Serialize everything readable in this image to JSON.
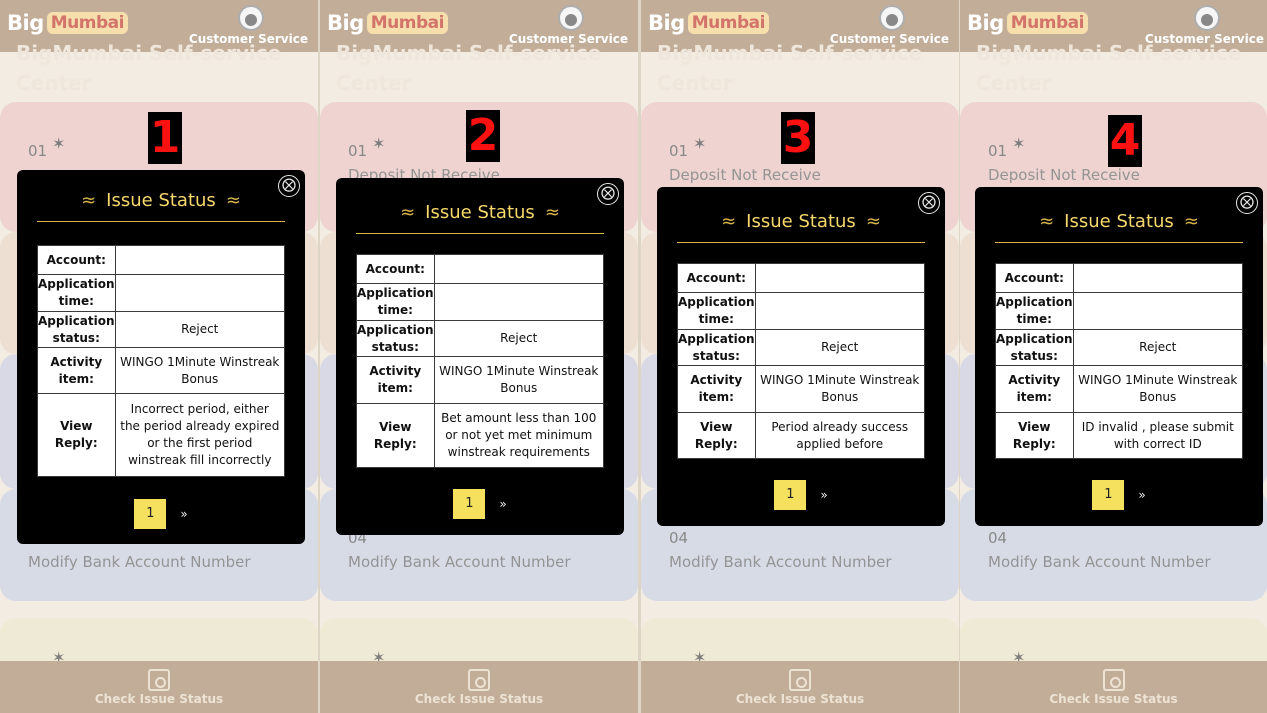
{
  "header": {
    "logo_big": "Big",
    "logo_mumbai": "Mumbai",
    "customer_service": "Customer Service"
  },
  "page": {
    "title_line1": "BigMumbai Self-service",
    "title_line2": "Center"
  },
  "cards": {
    "c1_num": "01",
    "c1_label": "Deposit Not Receive",
    "c4_num": "04",
    "c4_label": "Modify Bank Account Number"
  },
  "icons": {
    "star": "✶"
  },
  "footer": {
    "check_status": "Check Issue Status"
  },
  "modal": {
    "title": "Issue Status",
    "swirl_left": "≈",
    "swirl_right": "≈",
    "close": "⨂",
    "labels": {
      "account": "Account:",
      "application_time": "Application time:",
      "application_status": "Application status:",
      "activity_item": "Activity item:",
      "view_reply": "View Reply:"
    },
    "page_current": "1",
    "page_next": "»"
  },
  "panels": [
    {
      "number": "1",
      "status": "Reject",
      "activity": "WINGO 1Minute Winstreak Bonus",
      "reply": "Incorrect period, either the period already expired or the first period winstreak fill incorrectly"
    },
    {
      "number": "2",
      "status": "Reject",
      "activity": "WINGO 1Minute Winstreak Bonus",
      "reply": "Bet amount less than 100 or not yet met minimum winstreak requirements"
    },
    {
      "number": "3",
      "status": "Reject",
      "activity": "WINGO 1Minute Winstreak Bonus",
      "reply": "Period already success applied before"
    },
    {
      "number": "4",
      "status": "Reject",
      "activity": "WINGO 1Minute Winstreak Bonus",
      "reply": "ID invalid , please submit with correct ID"
    }
  ]
}
